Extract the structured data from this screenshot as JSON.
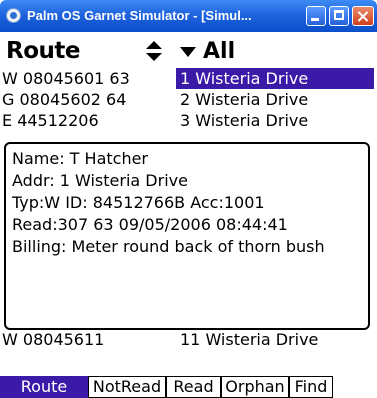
{
  "window": {
    "title": "Palm OS Garnet Simulator - [Simul..."
  },
  "header": {
    "title": "Route",
    "filter_label": "All"
  },
  "rows": [
    {
      "account": "W 08045601 63",
      "address": "1 Wisteria Drive",
      "selected": true
    },
    {
      "account": "G 08045602 64",
      "address": "2 Wisteria Drive",
      "selected": false
    },
    {
      "account": "E 44512206",
      "address": "3 Wisteria Drive",
      "selected": false
    }
  ],
  "popup": {
    "name": "Name: T Hatcher",
    "addr": "Addr: 1 Wisteria Drive",
    "typ": "Typ:W ID: 84512766B Acc:1001",
    "read": "Read:307 63 09/05/2006 08:44:41",
    "billing": "Billing: Meter round back of thorn bush"
  },
  "bottom_row": {
    "account": "W 08045611",
    "address": "11 Wisteria Drive"
  },
  "tabs": [
    "Route",
    "NotRead",
    "Read",
    "Orphan",
    "Find"
  ],
  "colors": {
    "selection": "#3a1aa6",
    "titlebar": "#1f63de"
  }
}
